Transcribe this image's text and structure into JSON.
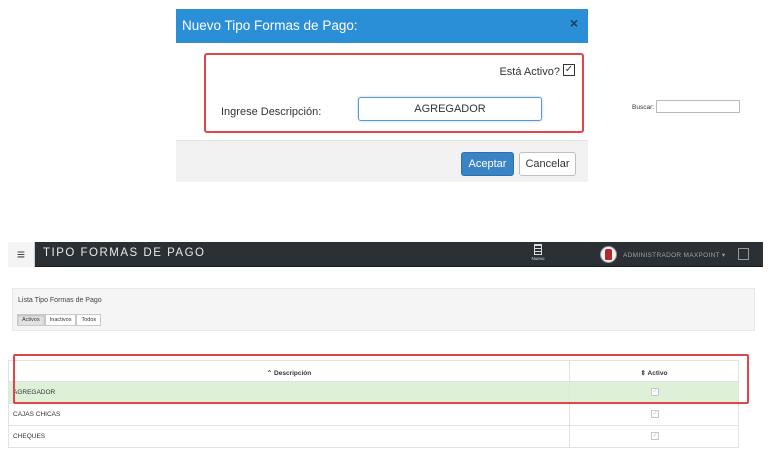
{
  "modal": {
    "title": "Nuevo Tipo Formas de Pago:",
    "close_icon": "×",
    "activo_label": "Está Activo?",
    "activo_checked": true,
    "activo_mark": "✓",
    "descripcion_label": "Ingrese Descripción:",
    "descripcion_value": "AGREGADOR",
    "accept_label": "Aceptar",
    "cancel_label": "Cancelar"
  },
  "app": {
    "menu_icon": "≡",
    "title": "TIPO FORMAS DE PAGO",
    "nuevo_label": "Nuevo",
    "user_name": "ADMINISTRADOR MAXPOINT ▾",
    "list_title": "Lista Tipo Formas de Pago",
    "filters": [
      "Activos",
      "Inactivos",
      "Todos"
    ],
    "active_filter": "Activos",
    "search_label": "Buscar:",
    "search_value": "",
    "columns": [
      "⌃ Descripción",
      "⇕ Activo"
    ],
    "rows": [
      {
        "descripcion": "AGREGADOR",
        "activo": true,
        "selected": true
      },
      {
        "descripcion": "CAJAS CHICAS",
        "activo": true,
        "selected": false
      },
      {
        "descripcion": "CHEQUES",
        "activo": true,
        "selected": false
      }
    ],
    "check_mark": "✓"
  },
  "colors": {
    "modal_header": "#2a8fd7",
    "highlight_box": "#e0454a",
    "topbar": "#2b3034",
    "selected_row": "#dff0d8",
    "primary_button": "#3a84c5"
  }
}
